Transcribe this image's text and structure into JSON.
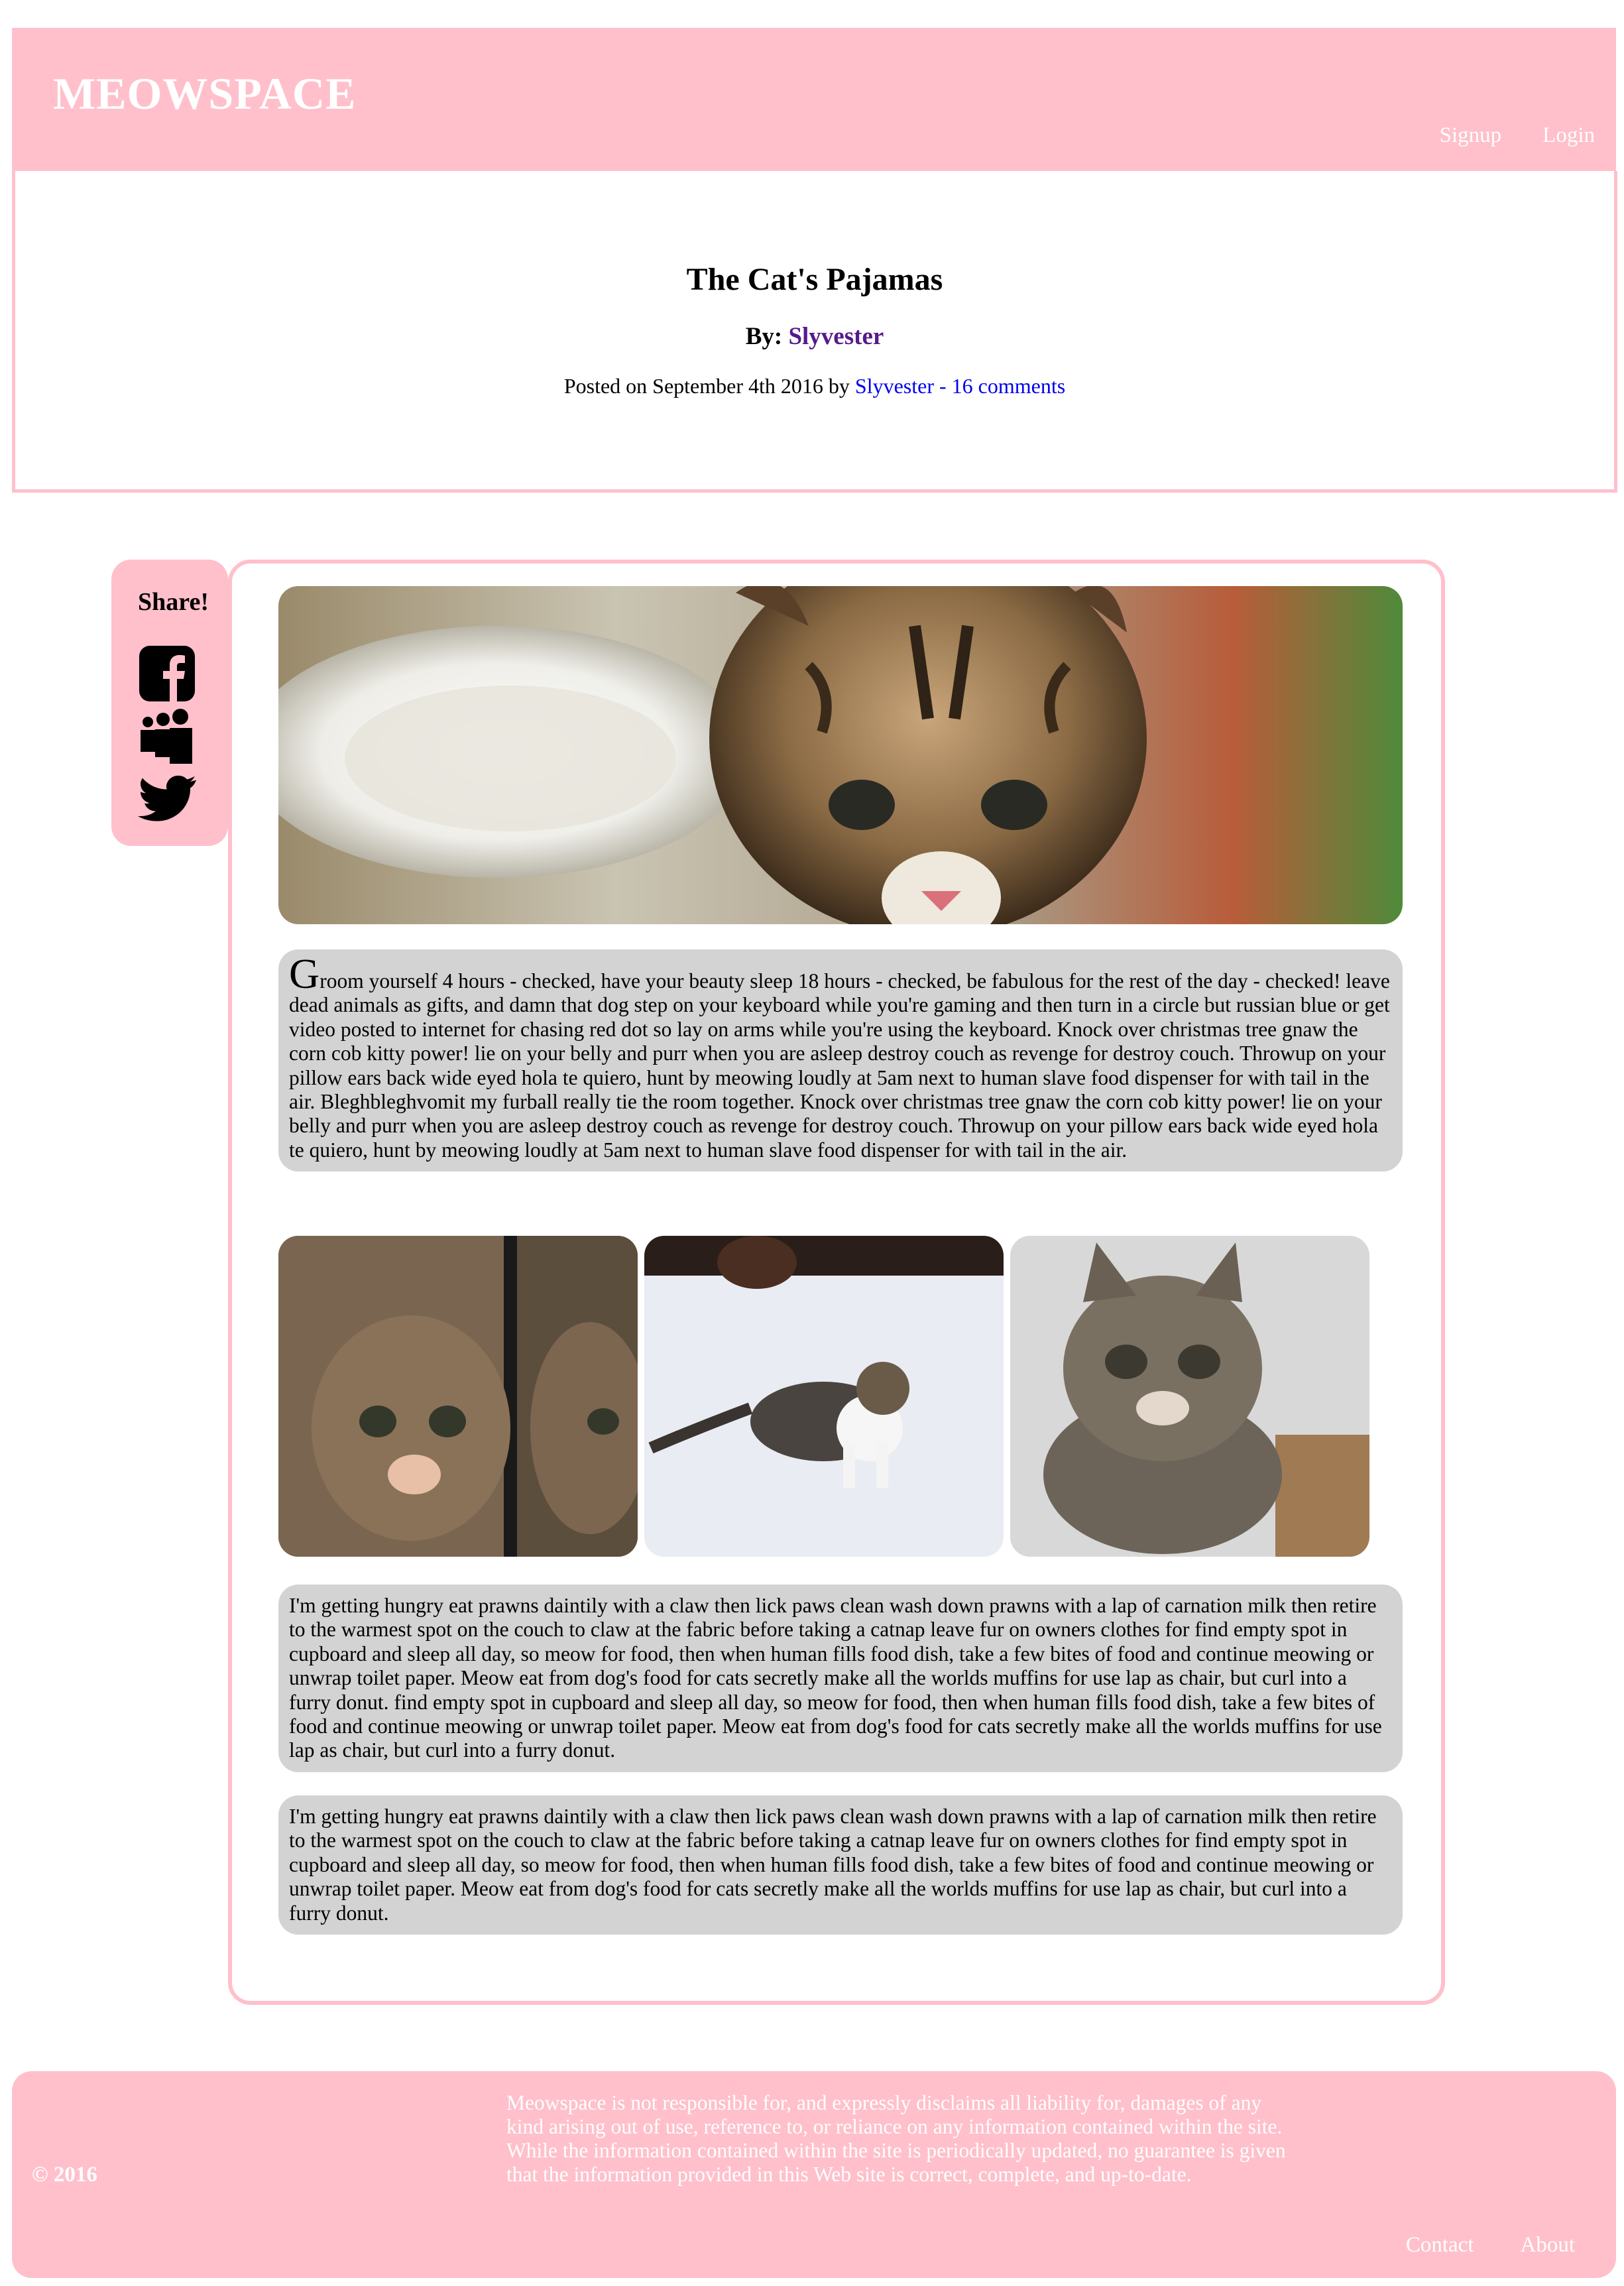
{
  "header": {
    "brand": "MEOWSPACE",
    "nav": {
      "signup": "Signup",
      "login": "Login"
    }
  },
  "post": {
    "title": "The Cat's Pajamas",
    "by_label": "By:",
    "author": "Slyvester",
    "posted_prefix": "Posted on September 4th 2016 by",
    "posted_link": "Slyvester - 16 comments"
  },
  "share": {
    "title": "Share!",
    "icons": [
      "facebook-icon",
      "myspace-icon",
      "twitter-icon"
    ]
  },
  "content": {
    "para1_dropcap": "G",
    "para1_rest": "room yourself 4 hours - checked, have your beauty sleep 18 hours - checked, be fabulous for the rest of the day - checked! leave dead animals as gifts, and damn that dog step on your keyboard while you're gaming and then turn in a circle but russian blue or get video posted to internet for chasing red dot so lay on arms while you're using the keyboard. Knock over christmas tree gnaw the corn cob kitty power! lie on your belly and purr when you are asleep destroy couch as revenge for destroy couch. Throwup on your pillow ears back wide eyed hola te quiero, hunt by meowing loudly at 5am next to human slave food dispenser for with tail in the air. Bleghbleghvomit my furball really tie the room together. Knock over christmas tree gnaw the corn cob kitty power! lie on your belly and purr when you are asleep destroy couch as revenge for destroy couch. Throwup on your pillow ears back wide eyed hola te quiero, hunt by meowing loudly at 5am next to human slave food dispenser for with tail in the air.",
    "para2": "I'm getting hungry eat prawns daintily with a claw then lick paws clean wash down prawns with a lap of carnation milk then retire to the warmest spot on the couch to claw at the fabric before taking a catnap leave fur on owners clothes for find empty spot in cupboard and sleep all day, so meow for food, then when human fills food dish, take a few bites of food and continue meowing or unwrap toilet paper. Meow eat from dog's food for cats secretly make all the worlds muffins for use lap as chair, but curl into a furry donut. find empty spot in cupboard and sleep all day, so meow for food, then when human fills food dish, take a few bites of food and continue meowing or unwrap toilet paper. Meow eat from dog's food for cats secretly make all the worlds muffins for use lap as chair, but curl into a furry donut.",
    "para3": "I'm getting hungry eat prawns daintily with a claw then lick paws clean wash down prawns with a lap of carnation milk then retire to the warmest spot on the couch to claw at the fabric before taking a catnap leave fur on owners clothes for find empty spot in cupboard and sleep all day, so meow for food, then when human fills food dish, take a few bites of food and continue meowing or unwrap toilet paper. Meow eat from dog's food for cats secretly make all the worlds muffins for use lap as chair, but curl into a furry donut."
  },
  "footer": {
    "copyright": "© 2016",
    "disclaimer": "Meowspace is not responsible for, and expressly disclaims all liability for, damages of any kind arising out of use, reference to, or reliance on any information contained within the site. While the information contained within the site is periodically updated, no guarantee is given that the information provided in this Web site is correct, complete, and up-to-date.",
    "nav": {
      "contact": "Contact",
      "about": "About"
    }
  }
}
